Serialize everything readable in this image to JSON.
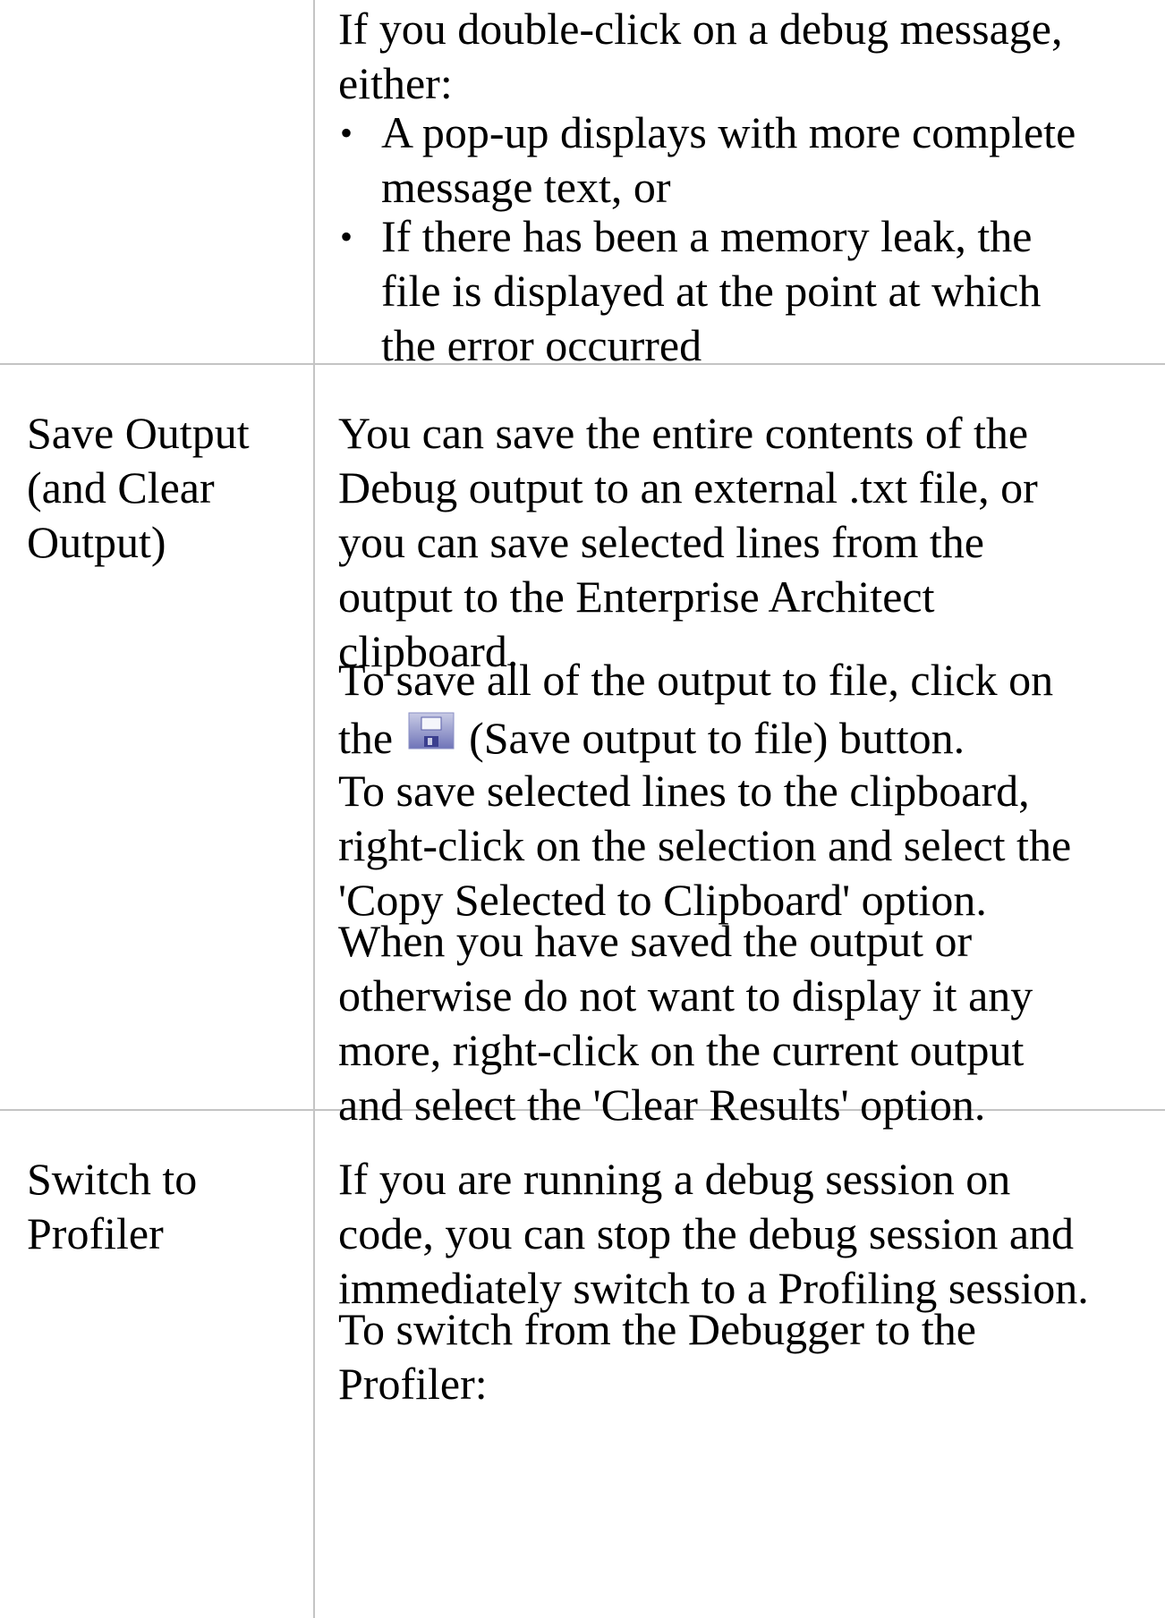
{
  "rows": [
    {
      "label": "",
      "intro": "If you double-click on a debug message,\neither:",
      "bullets": [
        "A pop-up displays with more complete\nmessage text, or",
        "If there has been a memory leak, the\nfile is displayed at the point at which\nthe error occurred"
      ]
    },
    {
      "label": "Save Output\n(and Clear\nOutput)",
      "p1": "You can save the entire contents of the\nDebug output to an external .txt file, or\nyou can save selected lines from the\noutput to the Enterprise Architect\nclipboard.",
      "p2_line1": "To save all of the output to file, click on",
      "p2_before_icon": "the",
      "p2_icon": "save-icon",
      "p2_after_icon": "(Save output to file) button.",
      "p3": "To save selected lines to the clipboard,\nright-click on the selection and select the\n'Copy Selected to Clipboard' option.",
      "p4": "When you have saved the output or\notherwise do not want to display it any\nmore, right-click on the current output\nand select the 'Clear Results' option."
    },
    {
      "label": "Switch to\nProfiler",
      "p1": "If you are running a debug session on\ncode, you can stop the debug session and\nimmediately switch to a Profiling session.",
      "p2": "To switch from the Debugger to the\nProfiler:"
    }
  ]
}
